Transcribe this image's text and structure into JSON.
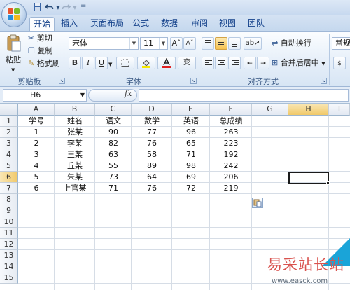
{
  "titlebar": {
    "qa_separator": "="
  },
  "tabs": [
    "开始",
    "插入",
    "页面布局",
    "公式",
    "数据",
    "审阅",
    "视图",
    "团队"
  ],
  "ribbon": {
    "clipboard": {
      "paste": "粘贴",
      "cut": "剪切",
      "copy": "复制",
      "format_painter": "格式刷",
      "label": "剪贴板"
    },
    "font": {
      "name": "宋体",
      "size": "11",
      "grow": "A˄",
      "shrink": "A˅",
      "bold": "B",
      "italic": "I",
      "underline": "U",
      "phonetic": "变",
      "label": "字体"
    },
    "alignment": {
      "wrap_text": "自动换行",
      "merge_center": "合并后居中",
      "label": "对齐方式"
    },
    "number": {
      "format": "常规"
    }
  },
  "formula_bar": {
    "name_box": "H6",
    "fx": "fx"
  },
  "grid": {
    "columns": [
      "A",
      "B",
      "C",
      "D",
      "E",
      "F",
      "G",
      "H",
      "I"
    ],
    "rows": [
      "1",
      "2",
      "3",
      "4",
      "5",
      "6",
      "7",
      "8",
      "9",
      "10",
      "11",
      "12",
      "13",
      "14",
      "15"
    ],
    "header_row": [
      "学号",
      "姓名",
      "语文",
      "数学",
      "英语",
      "总成绩"
    ],
    "data": [
      [
        "1",
        "张某",
        "90",
        "77",
        "96",
        "263"
      ],
      [
        "2",
        "李某",
        "82",
        "76",
        "65",
        "223"
      ],
      [
        "3",
        "王某",
        "63",
        "58",
        "71",
        "192"
      ],
      [
        "4",
        "丘某",
        "55",
        "89",
        "98",
        "242"
      ],
      [
        "5",
        "朱某",
        "73",
        "64",
        "69",
        "206"
      ],
      [
        "6",
        "上官某",
        "71",
        "76",
        "72",
        "219"
      ]
    ],
    "active_cell": "H6"
  },
  "watermark": {
    "text": "易采站长站",
    "url": "www.easck.com"
  },
  "colors": {
    "ribbon_text": "#15428b",
    "selected_header": "#f1c96a",
    "watermark": "#d9534f"
  }
}
